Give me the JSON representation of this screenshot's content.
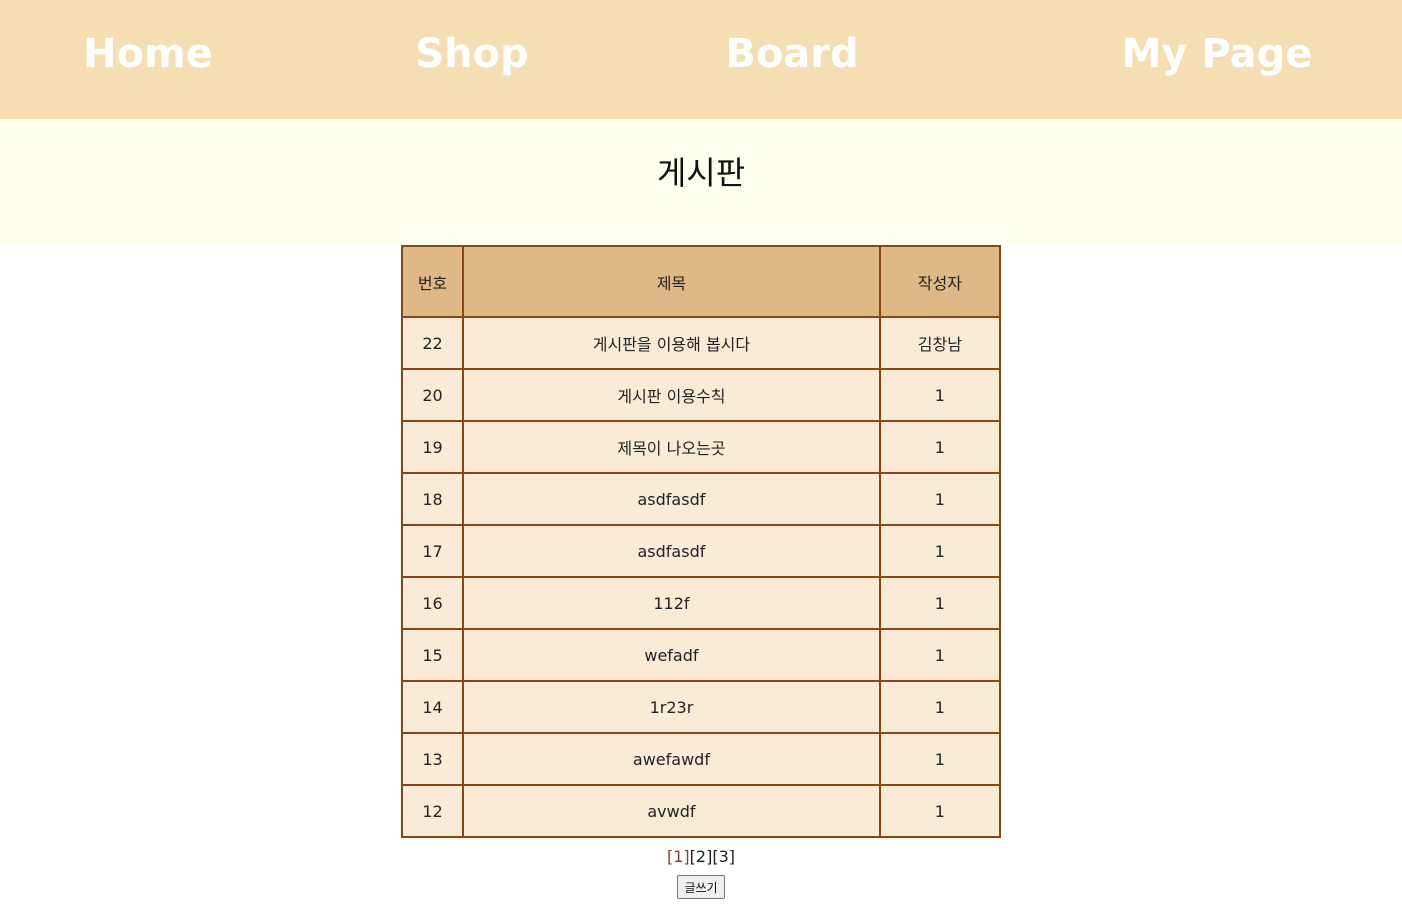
{
  "nav": {
    "home": "Home",
    "shop": "Shop",
    "board": "Board",
    "mypage": "My Page"
  },
  "page_title": "게시판",
  "table": {
    "headers": {
      "number": "번호",
      "title": "제목",
      "writer": "작성자"
    },
    "rows": [
      {
        "number": "22",
        "title": "게시판을 이용해 봅시다",
        "writer": "김창남"
      },
      {
        "number": "20",
        "title": "게시판 이용수칙",
        "writer": "1"
      },
      {
        "number": "19",
        "title": "제목이 나오는곳",
        "writer": "1"
      },
      {
        "number": "18",
        "title": "asdfasdf",
        "writer": "1"
      },
      {
        "number": "17",
        "title": "asdfasdf",
        "writer": "1"
      },
      {
        "number": "16",
        "title": "112f",
        "writer": "1"
      },
      {
        "number": "15",
        "title": "wefadf",
        "writer": "1"
      },
      {
        "number": "14",
        "title": "1r23r",
        "writer": "1"
      },
      {
        "number": "13",
        "title": "awefawdf",
        "writer": "1"
      },
      {
        "number": "12",
        "title": "avwdf",
        "writer": "1"
      }
    ]
  },
  "pagination": {
    "pages": [
      "[1]",
      "[2]",
      "[3]"
    ],
    "current": "[1]"
  },
  "write_button": "글쓰기",
  "colors": {
    "nav_bg": "#F5DEB3",
    "banner_bg": "#FFFFED",
    "header_bg": "#DEB887",
    "cell_bg": "#FAEBD7",
    "border": "#8B4513",
    "current_page": "#8B3A3A"
  }
}
